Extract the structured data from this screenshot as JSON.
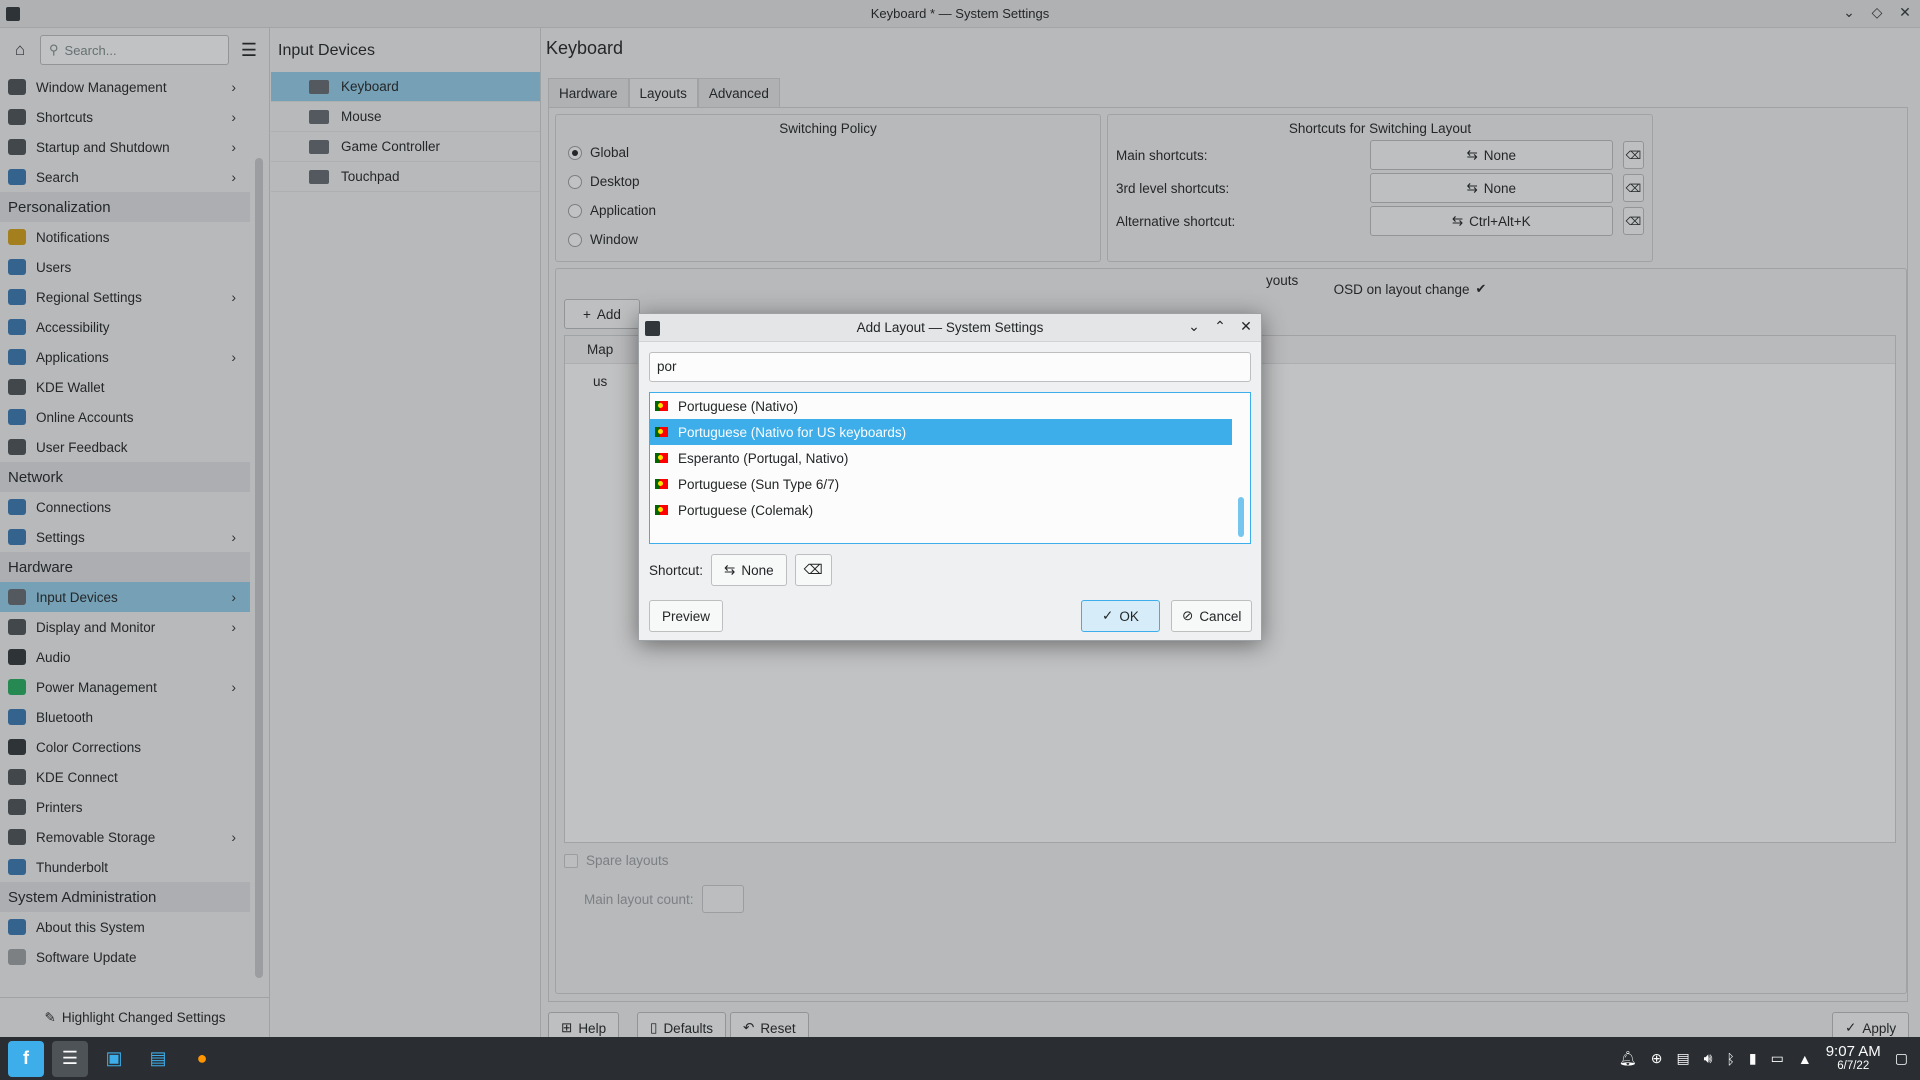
{
  "window": {
    "title": "Keyboard * — System Settings"
  },
  "sidebar": {
    "search_placeholder": "Search...",
    "items": [
      {
        "type": "item",
        "label": "Window Management",
        "chevron": true,
        "color": "#4d5357"
      },
      {
        "type": "item",
        "label": "Shortcuts",
        "chevron": true,
        "color": "#4d5357"
      },
      {
        "type": "item",
        "label": "Startup and Shutdown",
        "chevron": true,
        "color": "#4d5357"
      },
      {
        "type": "item",
        "label": "Search",
        "chevron": true,
        "color": "#3a79b3"
      },
      {
        "type": "category",
        "label": "Personalization"
      },
      {
        "type": "item",
        "label": "Notifications",
        "chevron": false,
        "color": "#d4a017"
      },
      {
        "type": "item",
        "label": "Users",
        "chevron": false,
        "color": "#3a79b3"
      },
      {
        "type": "item",
        "label": "Regional Settings",
        "chevron": true,
        "color": "#3a79b3"
      },
      {
        "type": "item",
        "label": "Accessibility",
        "chevron": false,
        "color": "#3a79b3"
      },
      {
        "type": "item",
        "label": "Applications",
        "chevron": true,
        "color": "#3a79b3"
      },
      {
        "type": "item",
        "label": "KDE Wallet",
        "chevron": false,
        "color": "#4d5357"
      },
      {
        "type": "item",
        "label": "Online Accounts",
        "chevron": false,
        "color": "#3a79b3"
      },
      {
        "type": "item",
        "label": "User Feedback",
        "chevron": false,
        "color": "#4d5357"
      },
      {
        "type": "category",
        "label": "Network"
      },
      {
        "type": "item",
        "label": "Connections",
        "chevron": false,
        "color": "#3a79b3"
      },
      {
        "type": "item",
        "label": "Settings",
        "chevron": true,
        "color": "#3a79b3"
      },
      {
        "type": "category",
        "label": "Hardware"
      },
      {
        "type": "item",
        "label": "Input Devices",
        "chevron": true,
        "active": true,
        "color": "#646b72"
      },
      {
        "type": "item",
        "label": "Display and Monitor",
        "chevron": true,
        "color": "#4d5357"
      },
      {
        "type": "item",
        "label": "Audio",
        "chevron": false,
        "color": "#31363b"
      },
      {
        "type": "item",
        "label": "Power Management",
        "chevron": true,
        "color": "#27ae60"
      },
      {
        "type": "item",
        "label": "Bluetooth",
        "chevron": false,
        "color": "#3a79b3"
      },
      {
        "type": "item",
        "label": "Color Corrections",
        "chevron": false,
        "color": "#31363b"
      },
      {
        "type": "item",
        "label": "KDE Connect",
        "chevron": false,
        "color": "#4d5357"
      },
      {
        "type": "item",
        "label": "Printers",
        "chevron": false,
        "color": "#4d5357"
      },
      {
        "type": "item",
        "label": "Removable Storage",
        "chevron": true,
        "color": "#4d5357"
      },
      {
        "type": "item",
        "label": "Thunderbolt",
        "chevron": false,
        "color": "#3a79b3"
      },
      {
        "type": "category",
        "label": "System Administration"
      },
      {
        "type": "item",
        "label": "About this System",
        "chevron": false,
        "color": "#3a79b3"
      },
      {
        "type": "item",
        "label": "Software Update",
        "chevron": false,
        "color": "#9da1a4"
      }
    ],
    "highlight_label": "Highlight Changed Settings"
  },
  "input_devices": {
    "title": "Input Devices",
    "items": [
      {
        "label": "Keyboard",
        "active": true
      },
      {
        "label": "Mouse",
        "active": false
      },
      {
        "label": "Game Controller",
        "active": false
      },
      {
        "label": "Touchpad",
        "active": false
      }
    ]
  },
  "main": {
    "title": "Keyboard",
    "tabs": [
      "Hardware",
      "Layouts",
      "Advanced"
    ],
    "active_tab": "Layouts",
    "switching_policy": {
      "title": "Switching Policy",
      "options": [
        "Global",
        "Desktop",
        "Application",
        "Window"
      ],
      "selected": "Global"
    },
    "shortcuts": {
      "title": "Shortcuts for Switching Layout",
      "rows": [
        {
          "label": "Main shortcuts:",
          "value": "None"
        },
        {
          "label": "3rd level shortcuts:",
          "value": "None"
        },
        {
          "label": "Alternative shortcut:",
          "value": "Ctrl+Alt+K"
        }
      ],
      "osd_label": "OSD on layout change",
      "osd_checked": true
    },
    "layouts_group_partial": "youts",
    "add_label": "Add",
    "table_header": "Map",
    "table_rows": [
      "us"
    ],
    "spare_layouts": "Spare layouts",
    "main_layout_count": "Main layout count:",
    "buttons": {
      "help": "Help",
      "defaults": "Defaults",
      "reset": "Reset",
      "apply": "Apply"
    }
  },
  "dialog": {
    "title": "Add Layout — System Settings",
    "filter_value": "por",
    "items": [
      {
        "label": "Portuguese (Nativo)",
        "selected": false
      },
      {
        "label": "Portuguese (Nativo for US keyboards)",
        "selected": true
      },
      {
        "label": "Esperanto (Portugal, Nativo)",
        "selected": false
      },
      {
        "label": "Portuguese (Sun Type 6/7)",
        "selected": false
      },
      {
        "label": "Portuguese (Colemak)",
        "selected": false
      }
    ],
    "shortcut_label": "Shortcut:",
    "shortcut_value": "None",
    "preview_label": "Preview",
    "ok_label": "OK",
    "cancel_label": "Cancel"
  },
  "taskbar": {
    "time": "9:07 AM",
    "date": "6/7/22"
  }
}
